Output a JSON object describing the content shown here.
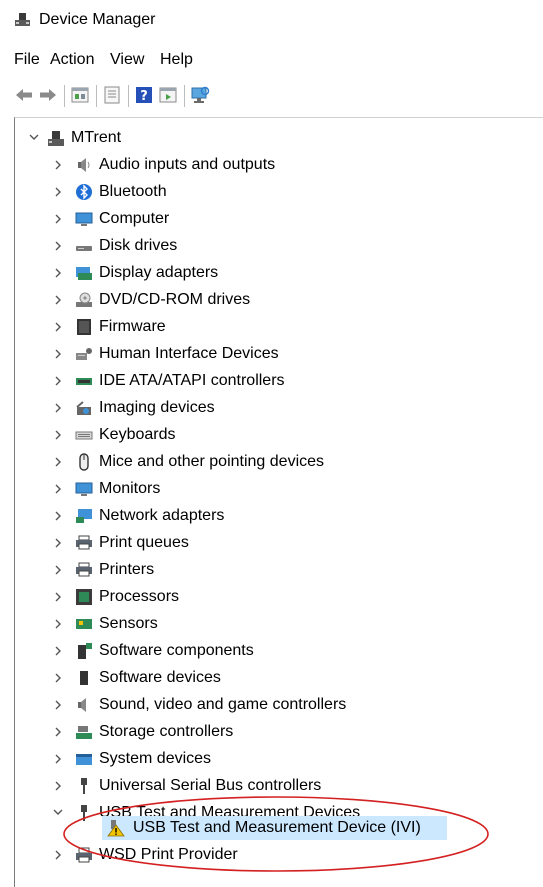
{
  "window": {
    "title": "Device Manager"
  },
  "menu": [
    "File",
    "Action",
    "View",
    "Help"
  ],
  "toolbar": {
    "buttons": [
      "back-icon",
      "forward-icon",
      "properties-view-icon",
      "scope-icon",
      "help-icon",
      "run-icon",
      "monitor-scan-icon"
    ]
  },
  "tree": {
    "root": "MTrent",
    "categories": [
      "Audio inputs and outputs",
      "Bluetooth",
      "Computer",
      "Disk drives",
      "Display adapters",
      "DVD/CD-ROM drives",
      "Firmware",
      "Human Interface Devices",
      "IDE ATA/ATAPI controllers",
      "Imaging devices",
      "Keyboards",
      "Mice and other pointing devices",
      "Monitors",
      "Network adapters",
      "Print queues",
      "Printers",
      "Processors",
      "Sensors",
      "Software components",
      "Software devices",
      "Sound, video and game controllers",
      "Storage controllers",
      "System devices",
      "Universal Serial Bus controllers",
      "USB Test and Measurement Devices"
    ],
    "expanded_child": "USB Test and Measurement Device (IVI)",
    "last_item": "WSD Print Provider"
  },
  "colors": {
    "selection": "#cce8ff",
    "annotation": "#d42020",
    "accent": "#2f7fd1"
  }
}
